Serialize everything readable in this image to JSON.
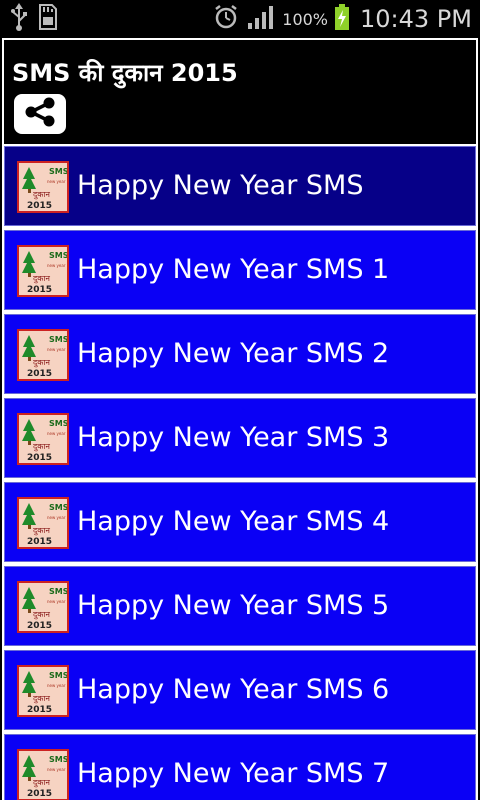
{
  "status_bar": {
    "icons_left": [
      "usb-icon",
      "sd-card-icon"
    ],
    "icons_right": [
      "alarm-icon",
      "signal-icon",
      "battery-icon"
    ],
    "battery_percent": "100%",
    "time": "10:43 PM"
  },
  "app": {
    "title": "SMS की दुकान 2015",
    "share_icon": "share-icon"
  },
  "list": {
    "items": [
      {
        "label": "Happy New Year SMS",
        "selected": true
      },
      {
        "label": "Happy New Year SMS 1",
        "selected": false
      },
      {
        "label": "Happy New Year SMS 2",
        "selected": false
      },
      {
        "label": "Happy New Year SMS 3",
        "selected": false
      },
      {
        "label": "Happy New Year SMS 4",
        "selected": false
      },
      {
        "label": "Happy New Year SMS 5",
        "selected": false
      },
      {
        "label": "Happy New Year SMS 6",
        "selected": false
      },
      {
        "label": "Happy New Year SMS 7",
        "selected": false
      }
    ]
  },
  "colors": {
    "row_bg": "#0a00f5",
    "row_selected_bg": "#060088",
    "actionbar_bg": "#000000",
    "battery_green": "#8fd12a"
  }
}
